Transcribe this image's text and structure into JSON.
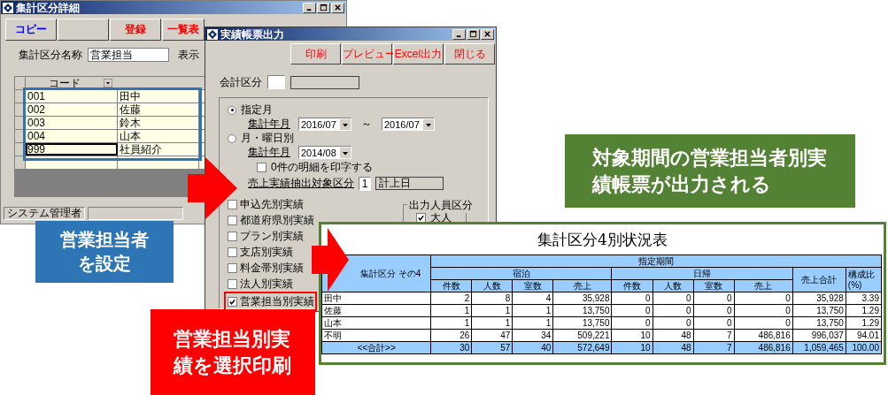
{
  "detail_window": {
    "title": "集計区分詳細",
    "buttons": [
      {
        "kind": "text",
        "label": "コピー",
        "color": "#0000ff"
      },
      {
        "kind": "blank"
      },
      {
        "kind": "text",
        "label": "登録",
        "color": "#ff0000"
      },
      {
        "kind": "text",
        "label": "一覧表",
        "color": "#ff0000"
      }
    ],
    "name_label": "集計区分名称",
    "name_value": "営業担当",
    "display_label": "表示",
    "grid": {
      "column": "コード",
      "highlighted": true,
      "rows": [
        {
          "code": "001",
          "name": "田中",
          "selected": false
        },
        {
          "code": "002",
          "name": "佐藤",
          "selected": false
        },
        {
          "code": "003",
          "name": "鈴木",
          "selected": false
        },
        {
          "code": "004",
          "name": "山本",
          "selected": false
        },
        {
          "code": "999",
          "name": "社員紹介",
          "selected": true
        }
      ]
    },
    "status_bar": "システム管理者"
  },
  "output_window": {
    "title": "実績帳票出力",
    "buttons": [
      "印刷",
      "プレビュー",
      "Excel出力",
      "閉じる"
    ],
    "account_label": "会計区分",
    "specified_month": {
      "label": "指定月",
      "selected": true,
      "field_label": "集計年月",
      "from": "2016/07",
      "separator": "～",
      "to": "2016/07"
    },
    "weekday": {
      "label": "月・曜日別",
      "selected": false,
      "field_label": "集計年月",
      "value": "2014/08"
    },
    "zero_option": {
      "label": "0件の明細を印字する",
      "checked": false
    },
    "extract": {
      "label": "売上実績抽出対象区分",
      "code": "1",
      "value": "計上日"
    },
    "reports": [
      {
        "label": "申込先別実績",
        "checked": false,
        "highlighted": false
      },
      {
        "label": "都道府県別実績",
        "checked": false,
        "highlighted": false
      },
      {
        "label": "プラン別実績",
        "checked": false,
        "highlighted": false
      },
      {
        "label": "支店別実績",
        "checked": false,
        "highlighted": false
      },
      {
        "label": "料金帯別実績",
        "checked": false,
        "highlighted": false
      },
      {
        "label": "法人別実績",
        "checked": false,
        "highlighted": false
      },
      {
        "label": "営業担当別実績",
        "checked": true,
        "highlighted": true
      }
    ],
    "people_group": {
      "title": "出力人員区分",
      "items": [
        {
          "label": "大人",
          "checked": true
        }
      ]
    }
  },
  "report": {
    "title": "集計区分4別状況表",
    "row_header": "集計区分 その4",
    "period": "指定期間",
    "groups": [
      {
        "label": "宿泊",
        "columns": [
          "件数",
          "人数",
          "室数",
          "売上"
        ]
      },
      {
        "label": "日帰",
        "columns": [
          "件数",
          "人数",
          "室数",
          "売上"
        ]
      }
    ],
    "total_sales": "売上合計",
    "ratio": [
      "構成比",
      "(%)"
    ],
    "rows": [
      {
        "kind": "data",
        "label": "田中",
        "values": [
          "2",
          "8",
          "4",
          "35,928",
          "0",
          "0",
          "0",
          "0",
          "35,928",
          "3.39"
        ]
      },
      {
        "kind": "data",
        "label": "佐藤",
        "values": [
          "1",
          "1",
          "1",
          "13,750",
          "0",
          "0",
          "0",
          "0",
          "13,750",
          "1.29"
        ]
      },
      {
        "kind": "data",
        "label": "山本",
        "values": [
          "1",
          "1",
          "1",
          "13,750",
          "0",
          "0",
          "0",
          "0",
          "13,750",
          "1.29"
        ]
      },
      {
        "kind": "data",
        "label": "不明",
        "values": [
          "26",
          "47",
          "34",
          "509,221",
          "10",
          "48",
          "7",
          "486,816",
          "996,037",
          "94.01"
        ]
      },
      {
        "kind": "total",
        "label": "<<合計>>",
        "values": [
          "30",
          "57",
          "40",
          "572,649",
          "10",
          "48",
          "7",
          "486,816",
          "1,059,465",
          "100.00"
        ]
      }
    ]
  },
  "callouts": [
    {
      "text": "営業担当者を設定",
      "color": "#2e75b6"
    },
    {
      "text": "営業担当別実績を選択印刷",
      "color": "#ff0000"
    },
    {
      "text": "対象期間の営業担当者別実績帳票が出力される",
      "color": "#548235"
    }
  ]
}
